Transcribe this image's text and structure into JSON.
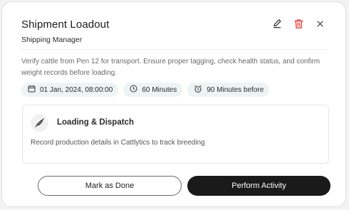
{
  "card": {
    "title": "Shipment Loadout",
    "subtitle": "Shipping Manager",
    "description": "Verify cattle from Pen 12 for transport. Ensure proper tagging, check health status, and confirm weight records before loading."
  },
  "header_actions": {
    "edit_icon": "pencil-icon",
    "delete_icon": "trash-icon",
    "close_icon": "close-icon",
    "delete_color": "#e53935"
  },
  "chips": [
    {
      "icon": "calendar-icon",
      "label": "01 Jan, 2024, 08:00:00"
    },
    {
      "icon": "clock-icon",
      "label": "60 Minutes"
    },
    {
      "icon": "alarm-icon",
      "label": "90 Minutes before"
    }
  ],
  "activity": {
    "icon": "dna-icon",
    "title": "Loading & Dispatch",
    "description": "Record production details in Cattlytics to track breeding"
  },
  "buttons": {
    "mark_done": "Mark as Done",
    "perform": "Perform Activity"
  }
}
